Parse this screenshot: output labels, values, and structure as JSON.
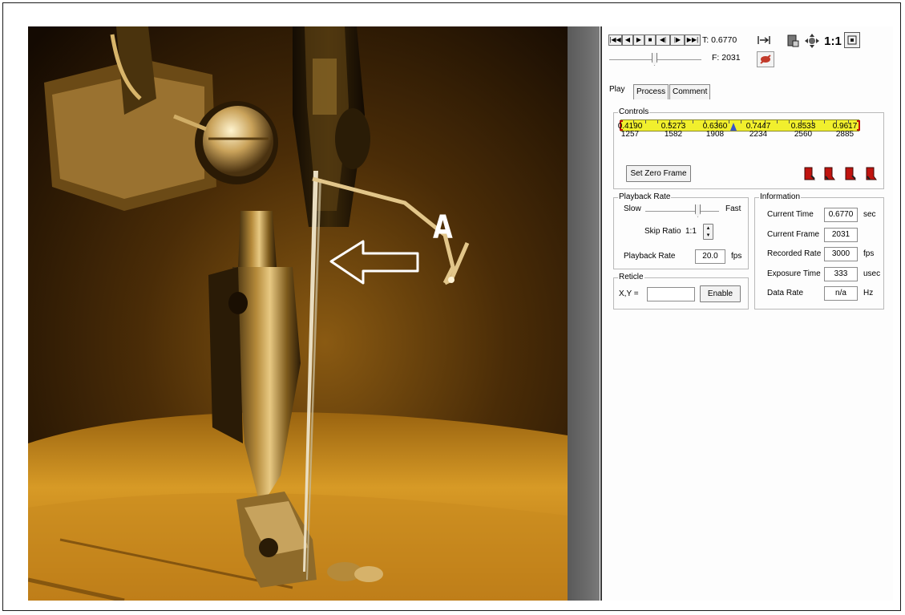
{
  "video": {
    "annotation_label": "A"
  },
  "toolbar": {
    "transport": [
      {
        "name": "first-frame-button",
        "glyph": "|◀◀"
      },
      {
        "name": "step-back-button",
        "glyph": "◀"
      },
      {
        "name": "play-button",
        "glyph": "▶"
      },
      {
        "name": "stop-button",
        "glyph": "■"
      },
      {
        "name": "prev-frame-button",
        "glyph": "◀|"
      },
      {
        "name": "next-frame-button",
        "glyph": "|▶"
      },
      {
        "name": "last-frame-button",
        "glyph": "▶▶|"
      }
    ],
    "time_readout": "T: 0.6770",
    "frame_readout": "F: 2031",
    "zoom_label": "1:1",
    "icons": [
      "fit-width-icon",
      "no-record-icon",
      "camera-icon",
      "move-icon",
      "actual-size-icon",
      "fullscreen-icon"
    ]
  },
  "tabs": [
    {
      "label": "Play",
      "active": true
    },
    {
      "label": "Process",
      "active": false
    },
    {
      "label": "Comment",
      "active": false
    }
  ],
  "controls": {
    "title": "Controls",
    "times": [
      "0.4190",
      "0.5273",
      "0.6360",
      "0.7447",
      "0.8533",
      "0.9617"
    ],
    "frames": [
      "1257",
      "1582",
      "1908",
      "2234",
      "2560",
      "2885"
    ],
    "current_fraction": 0.47,
    "set_zero_label": "Set Zero Frame",
    "timeline_color": "#f1ef2d",
    "marker_color": "#c0140f"
  },
  "playback": {
    "title": "Playback Rate",
    "slow_label": "Slow",
    "fast_label": "Fast",
    "speed_fraction": 0.75,
    "skip_ratio_label": "Skip Ratio",
    "skip_ratio_value": "1:1",
    "rate_label": "Playback Rate",
    "rate_value": "20.0",
    "rate_unit": "fps"
  },
  "reticle": {
    "title": "Reticle",
    "xy_label": "X,Y =",
    "xy_value": "",
    "enable_label": "Enable"
  },
  "information": {
    "title": "Information",
    "rows": [
      {
        "label": "Current Time",
        "value": "0.6770",
        "unit": "sec"
      },
      {
        "label": "Current Frame",
        "value": "2031",
        "unit": ""
      },
      {
        "label": "Recorded Rate",
        "value": "3000",
        "unit": "fps"
      },
      {
        "label": "Exposure Time",
        "value": "333",
        "unit": "usec"
      },
      {
        "label": "Data Rate",
        "value": "n/a",
        "unit": "Hz"
      }
    ]
  }
}
